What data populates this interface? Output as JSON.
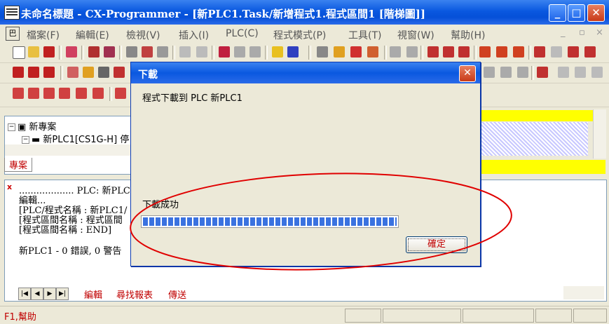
{
  "window": {
    "title": "未命名標題 - CX-Programmer - [新PLC1.Task/新增程式1.程式區間1 [階梯圖]]",
    "minimize_glyph": "_",
    "maximize_glyph": "□",
    "close_glyph": "✕"
  },
  "menubar": {
    "items": [
      "檔案(F)",
      "編輯(E)",
      "檢視(V)",
      "插入(I)",
      "PLC(C)",
      "程式模式(P)",
      "工具(T)",
      "視窗(W)",
      "幫助(H)"
    ],
    "mdi_buttons": [
      "_",
      "▫",
      "×"
    ]
  },
  "project": {
    "root": "新專案",
    "plc": "新PLC1[CS1G-H] 停",
    "tab": "專案"
  },
  "output": {
    "lines": [
      "................... PLC: 新PLC1",
      "編輯...",
      "[PLC/程式名稱 : 新PLC1/",
      "[程式區間名稱 : 程式區間",
      "[程式區間名稱 : END]",
      "新PLC1 - 0 錯誤, 0 警告"
    ],
    "tabs": [
      "編輯",
      "尋找報表",
      "傳送"
    ]
  },
  "statusbar": {
    "text": "F1,幫助"
  },
  "dialog": {
    "title": "下載",
    "close_glyph": "✕",
    "message": "程式下載到 PLC 新PLC1",
    "status": "下載成功",
    "progress": 1.0,
    "ok_label": "確定"
  },
  "colors": {
    "titlebar": "#0a58e0",
    "annotation": "#e00000",
    "highlight_yellow": "#ffff00",
    "status_text": "#c00000"
  },
  "icons": [
    "new-file-icon",
    "open-folder-icon",
    "save-icon",
    "print-preview-icon",
    "print-icon",
    "cut-icon",
    "copy-icon",
    "paste-icon",
    "undo-icon",
    "redo-icon",
    "find-icon",
    "replace-icon",
    "help-icon",
    "context-help-icon"
  ]
}
